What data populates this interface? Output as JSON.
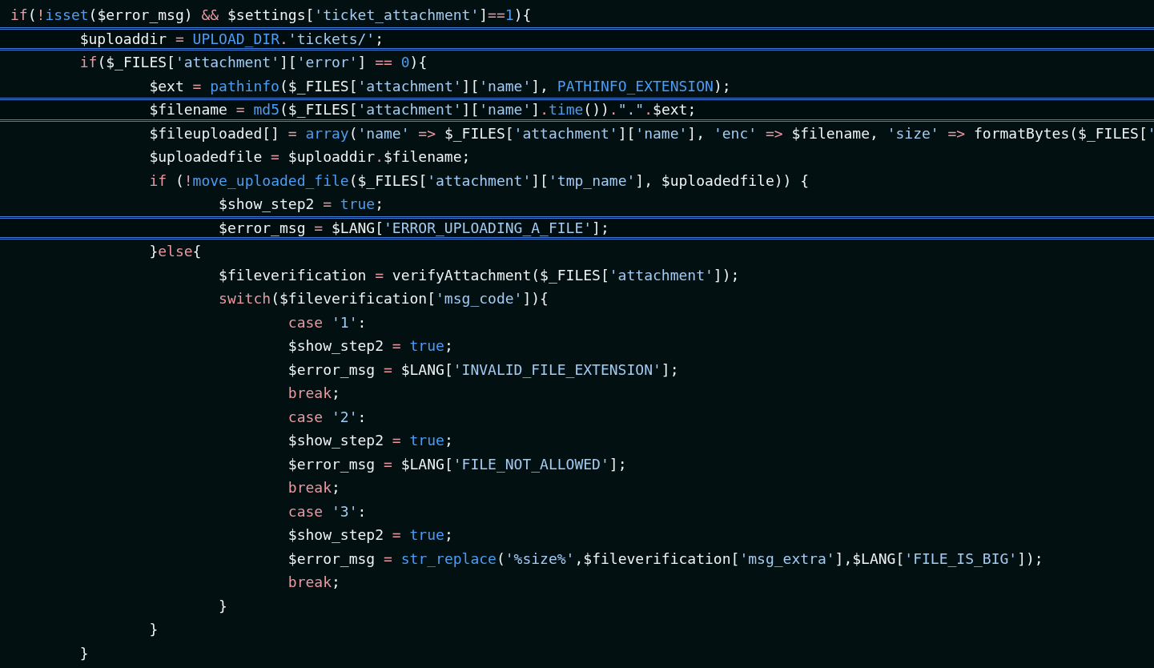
{
  "editor": {
    "lines": [
      {
        "highlighted": false,
        "tokens": [
          {
            "kind": "kw",
            "text": "if"
          },
          {
            "kind": "plain",
            "text": "("
          },
          {
            "kind": "kw",
            "text": "!"
          },
          {
            "kind": "fn",
            "text": "isset"
          },
          {
            "kind": "plain",
            "text": "($error_msg) "
          },
          {
            "kind": "kw",
            "text": "&&"
          },
          {
            "kind": "plain",
            "text": " $settings["
          },
          {
            "kind": "str",
            "text": "'ticket_attachment'"
          },
          {
            "kind": "plain",
            "text": "]"
          },
          {
            "kind": "kw",
            "text": "=="
          },
          {
            "kind": "fn",
            "text": "1"
          },
          {
            "kind": "plain",
            "text": "){"
          }
        ],
        "children": [
          {
            "highlighted": true,
            "tokens": [
              {
                "kind": "plain",
                "text": "$uploaddir "
              },
              {
                "kind": "kw",
                "text": "= "
              },
              {
                "kind": "fn",
                "text": "UPLOAD_DIR"
              },
              {
                "kind": "kw",
                "text": "."
              },
              {
                "kind": "str",
                "text": "'tickets/'"
              },
              {
                "kind": "plain",
                "text": ";"
              }
            ]
          },
          {
            "highlighted": false,
            "tokens": [
              {
                "kind": "kw",
                "text": "if"
              },
              {
                "kind": "plain",
                "text": "($_FILES["
              },
              {
                "kind": "str",
                "text": "'attachment'"
              },
              {
                "kind": "plain",
                "text": "]["
              },
              {
                "kind": "str",
                "text": "'error'"
              },
              {
                "kind": "plain",
                "text": "] "
              },
              {
                "kind": "kw",
                "text": "== "
              },
              {
                "kind": "fn",
                "text": "0"
              },
              {
                "kind": "plain",
                "text": "){"
              }
            ],
            "children": [
              {
                "highlighted": false,
                "tokens": [
                  {
                    "kind": "plain",
                    "text": "$ext "
                  },
                  {
                    "kind": "kw",
                    "text": "= "
                  },
                  {
                    "kind": "fn",
                    "text": "pathinfo"
                  },
                  {
                    "kind": "plain",
                    "text": "($_FILES["
                  },
                  {
                    "kind": "str",
                    "text": "'attachment'"
                  },
                  {
                    "kind": "plain",
                    "text": "]["
                  },
                  {
                    "kind": "str",
                    "text": "'name'"
                  },
                  {
                    "kind": "plain",
                    "text": "], "
                  },
                  {
                    "kind": "fn",
                    "text": "PATHINFO_EXTENSION"
                  },
                  {
                    "kind": "plain",
                    "text": ");"
                  }
                ]
              },
              {
                "highlighted": true,
                "tokens": [
                  {
                    "kind": "plain",
                    "text": "$filename "
                  },
                  {
                    "kind": "kw",
                    "text": "= "
                  },
                  {
                    "kind": "fn",
                    "text": "md5"
                  },
                  {
                    "kind": "plain",
                    "text": "($_FILES["
                  },
                  {
                    "kind": "str",
                    "text": "'attachment'"
                  },
                  {
                    "kind": "plain",
                    "text": "]["
                  },
                  {
                    "kind": "str",
                    "text": "'name'"
                  },
                  {
                    "kind": "plain",
                    "text": "]"
                  },
                  {
                    "kind": "kw",
                    "text": "."
                  },
                  {
                    "kind": "fn",
                    "text": "time"
                  },
                  {
                    "kind": "plain",
                    "text": "())"
                  },
                  {
                    "kind": "kw",
                    "text": "."
                  },
                  {
                    "kind": "str",
                    "text": "\".\""
                  },
                  {
                    "kind": "kw",
                    "text": "."
                  },
                  {
                    "kind": "plain",
                    "text": "$ext;"
                  }
                ]
              },
              {
                "highlighted": false,
                "tokens": [
                  {
                    "kind": "plain",
                    "text": "$fileuploaded[] "
                  },
                  {
                    "kind": "kw",
                    "text": "= "
                  },
                  {
                    "kind": "fn",
                    "text": "array"
                  },
                  {
                    "kind": "plain",
                    "text": "("
                  },
                  {
                    "kind": "str",
                    "text": "'name' "
                  },
                  {
                    "kind": "kw",
                    "text": "=>"
                  },
                  {
                    "kind": "plain",
                    "text": " $_FILES["
                  },
                  {
                    "kind": "str",
                    "text": "'attachment'"
                  },
                  {
                    "kind": "plain",
                    "text": "]["
                  },
                  {
                    "kind": "str",
                    "text": "'name'"
                  },
                  {
                    "kind": "plain",
                    "text": "], "
                  },
                  {
                    "kind": "str",
                    "text": "'enc' "
                  },
                  {
                    "kind": "kw",
                    "text": "=>"
                  },
                  {
                    "kind": "plain",
                    "text": " $filename, "
                  },
                  {
                    "kind": "str",
                    "text": "'size' "
                  },
                  {
                    "kind": "kw",
                    "text": "=>"
                  },
                  {
                    "kind": "plain",
                    "text": " formatBytes($_FILES["
                  },
                  {
                    "kind": "str",
                    "text": "'"
                  }
                ]
              },
              {
                "highlighted": false,
                "tokens": [
                  {
                    "kind": "plain",
                    "text": "$uploadedfile "
                  },
                  {
                    "kind": "kw",
                    "text": "="
                  },
                  {
                    "kind": "plain",
                    "text": " $uploaddir"
                  },
                  {
                    "kind": "kw",
                    "text": "."
                  },
                  {
                    "kind": "plain",
                    "text": "$filename;"
                  }
                ]
              },
              {
                "highlighted": false,
                "tokens": [
                  {
                    "kind": "kw",
                    "text": "if"
                  },
                  {
                    "kind": "plain",
                    "text": " ("
                  },
                  {
                    "kind": "kw",
                    "text": "!"
                  },
                  {
                    "kind": "fn",
                    "text": "move_uploaded_file"
                  },
                  {
                    "kind": "plain",
                    "text": "($_FILES["
                  },
                  {
                    "kind": "str",
                    "text": "'attachment'"
                  },
                  {
                    "kind": "plain",
                    "text": "]["
                  },
                  {
                    "kind": "str",
                    "text": "'tmp_name'"
                  },
                  {
                    "kind": "plain",
                    "text": "], $uploadedfile)) {"
                  }
                ],
                "children": [
                  {
                    "highlighted": false,
                    "tokens": [
                      {
                        "kind": "plain",
                        "text": "$show_step2 "
                      },
                      {
                        "kind": "kw",
                        "text": "= "
                      },
                      {
                        "kind": "fn",
                        "text": "true"
                      },
                      {
                        "kind": "plain",
                        "text": ";"
                      }
                    ]
                  },
                  {
                    "highlighted": true,
                    "tokens": [
                      {
                        "kind": "plain",
                        "text": "$error_msg "
                      },
                      {
                        "kind": "kw",
                        "text": "="
                      },
                      {
                        "kind": "plain",
                        "text": " $LANG["
                      },
                      {
                        "kind": "str",
                        "text": "'ERROR_UPLOADING_A_FILE'"
                      },
                      {
                        "kind": "plain",
                        "text": "];"
                      }
                    ]
                  }
                ]
              },
              {
                "highlighted": false,
                "tokens": [
                  {
                    "kind": "plain",
                    "text": "}"
                  },
                  {
                    "kind": "kw",
                    "text": "else"
                  },
                  {
                    "kind": "plain",
                    "text": "{"
                  }
                ],
                "children": [
                  {
                    "highlighted": false,
                    "tokens": [
                      {
                        "kind": "plain",
                        "text": "$fileverification "
                      },
                      {
                        "kind": "kw",
                        "text": "="
                      },
                      {
                        "kind": "plain",
                        "text": " verifyAttachment($_FILES["
                      },
                      {
                        "kind": "str",
                        "text": "'attachment'"
                      },
                      {
                        "kind": "plain",
                        "text": "]);"
                      }
                    ]
                  },
                  {
                    "highlighted": false,
                    "tokens": [
                      {
                        "kind": "kw",
                        "text": "switch"
                      },
                      {
                        "kind": "plain",
                        "text": "($fileverification["
                      },
                      {
                        "kind": "str",
                        "text": "'msg_code'"
                      },
                      {
                        "kind": "plain",
                        "text": "]){"
                      }
                    ],
                    "children": [
                      {
                        "highlighted": false,
                        "tokens": [
                          {
                            "kind": "kw",
                            "text": "case "
                          },
                          {
                            "kind": "str",
                            "text": "'1'"
                          },
                          {
                            "kind": "plain",
                            "text": ":"
                          }
                        ]
                      },
                      {
                        "highlighted": false,
                        "tokens": [
                          {
                            "kind": "plain",
                            "text": "$show_step2 "
                          },
                          {
                            "kind": "kw",
                            "text": "= "
                          },
                          {
                            "kind": "fn",
                            "text": "true"
                          },
                          {
                            "kind": "plain",
                            "text": ";"
                          }
                        ]
                      },
                      {
                        "highlighted": false,
                        "tokens": [
                          {
                            "kind": "plain",
                            "text": "$error_msg "
                          },
                          {
                            "kind": "kw",
                            "text": "="
                          },
                          {
                            "kind": "plain",
                            "text": " $LANG["
                          },
                          {
                            "kind": "str",
                            "text": "'INVALID_FILE_EXTENSION'"
                          },
                          {
                            "kind": "plain",
                            "text": "];"
                          }
                        ]
                      },
                      {
                        "highlighted": false,
                        "tokens": [
                          {
                            "kind": "kw",
                            "text": "break"
                          },
                          {
                            "kind": "plain",
                            "text": ";"
                          }
                        ]
                      },
                      {
                        "highlighted": false,
                        "tokens": [
                          {
                            "kind": "kw",
                            "text": "case "
                          },
                          {
                            "kind": "str",
                            "text": "'2'"
                          },
                          {
                            "kind": "plain",
                            "text": ":"
                          }
                        ]
                      },
                      {
                        "highlighted": false,
                        "tokens": [
                          {
                            "kind": "plain",
                            "text": "$show_step2 "
                          },
                          {
                            "kind": "kw",
                            "text": "= "
                          },
                          {
                            "kind": "fn",
                            "text": "true"
                          },
                          {
                            "kind": "plain",
                            "text": ";"
                          }
                        ]
                      },
                      {
                        "highlighted": false,
                        "tokens": [
                          {
                            "kind": "plain",
                            "text": "$error_msg "
                          },
                          {
                            "kind": "kw",
                            "text": "="
                          },
                          {
                            "kind": "plain",
                            "text": " $LANG["
                          },
                          {
                            "kind": "str",
                            "text": "'FILE_NOT_ALLOWED'"
                          },
                          {
                            "kind": "plain",
                            "text": "];"
                          }
                        ]
                      },
                      {
                        "highlighted": false,
                        "tokens": [
                          {
                            "kind": "kw",
                            "text": "break"
                          },
                          {
                            "kind": "plain",
                            "text": ";"
                          }
                        ]
                      },
                      {
                        "highlighted": false,
                        "tokens": [
                          {
                            "kind": "kw",
                            "text": "case "
                          },
                          {
                            "kind": "str",
                            "text": "'3'"
                          },
                          {
                            "kind": "plain",
                            "text": ":"
                          }
                        ]
                      },
                      {
                        "highlighted": false,
                        "tokens": [
                          {
                            "kind": "plain",
                            "text": "$show_step2 "
                          },
                          {
                            "kind": "kw",
                            "text": "= "
                          },
                          {
                            "kind": "fn",
                            "text": "true"
                          },
                          {
                            "kind": "plain",
                            "text": ";"
                          }
                        ]
                      },
                      {
                        "highlighted": false,
                        "tokens": [
                          {
                            "kind": "plain",
                            "text": "$error_msg "
                          },
                          {
                            "kind": "kw",
                            "text": "= "
                          },
                          {
                            "kind": "fn",
                            "text": "str_replace"
                          },
                          {
                            "kind": "plain",
                            "text": "("
                          },
                          {
                            "kind": "str",
                            "text": "'%size%'"
                          },
                          {
                            "kind": "plain",
                            "text": ",$fileverification["
                          },
                          {
                            "kind": "str",
                            "text": "'msg_extra'"
                          },
                          {
                            "kind": "plain",
                            "text": "],$LANG["
                          },
                          {
                            "kind": "str",
                            "text": "'FILE_IS_BIG'"
                          },
                          {
                            "kind": "plain",
                            "text": "]);"
                          }
                        ]
                      },
                      {
                        "highlighted": false,
                        "tokens": [
                          {
                            "kind": "kw",
                            "text": "break"
                          },
                          {
                            "kind": "plain",
                            "text": ";"
                          }
                        ]
                      }
                    ]
                  },
                  {
                    "highlighted": false,
                    "tokens": [
                      {
                        "kind": "plain",
                        "text": "}"
                      }
                    ]
                  }
                ]
              },
              {
                "highlighted": false,
                "tokens": [
                  {
                    "kind": "plain",
                    "text": "}"
                  }
                ]
              }
            ]
          },
          {
            "highlighted": false,
            "tokens": [
              {
                "kind": "plain",
                "text": "}"
              }
            ]
          }
        ]
      }
    ]
  }
}
